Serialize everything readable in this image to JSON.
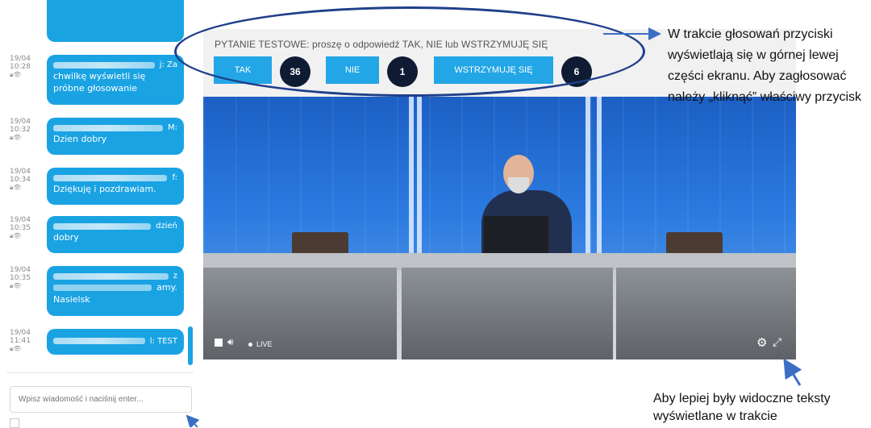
{
  "chat": {
    "messages": [
      {
        "date": "19/04",
        "time": "10:28",
        "author_suffix": "j: Za",
        "text": "chwilkę wyświetli się próbne głosowanie"
      },
      {
        "date": "19/04",
        "time": "10:32",
        "author_suffix": "M:",
        "text": "Dzien dobry"
      },
      {
        "date": "19/04",
        "time": "10:34",
        "author_suffix": "f:",
        "text": "Dziękuję i pozdrawiam."
      },
      {
        "date": "19/04",
        "time": "10:35",
        "author_suffix": "dzień",
        "text": "dobry"
      },
      {
        "date": "19/04",
        "time": "10:35",
        "author_suffix": "z",
        "text_line2": "amy.",
        "text": "Nasielsk"
      },
      {
        "date": "19/04",
        "time": "11:41",
        "author_suffix": "l: TEST",
        "text": ""
      }
    ],
    "input_placeholder": "Wpisz wiadomość i naciśnij enter..."
  },
  "voting": {
    "question": "PYTANIE TESTOWE: proszę o odpowiedź TAK, NIE lub WSTRZYMUJĘ SIĘ",
    "options": [
      {
        "label": "TAK",
        "count": "36"
      },
      {
        "label": "NIE",
        "count": "1"
      },
      {
        "label": "WSTRZYMUJĘ SIĘ",
        "count": "6"
      }
    ]
  },
  "player": {
    "live_label": "LIVE",
    "icons": [
      "stop-icon",
      "volume-icon",
      "live-dot-icon",
      "settings-icon",
      "fullscreen-icon"
    ]
  },
  "annotations": {
    "top_note": "W trakcie głosowań przyciski wyświetlają się w górnej lewej części ekranu. Aby zagłosować należy „kliknąć” właściwy przycisk",
    "bottom_note": "Aby lepiej były widoczne teksty wyświetlane w trakcie"
  },
  "colors": {
    "accent": "#23a6e6",
    "count_bg": "#0f1b33",
    "oval": "#1f3f8a",
    "arrow": "#3b6fc4"
  }
}
